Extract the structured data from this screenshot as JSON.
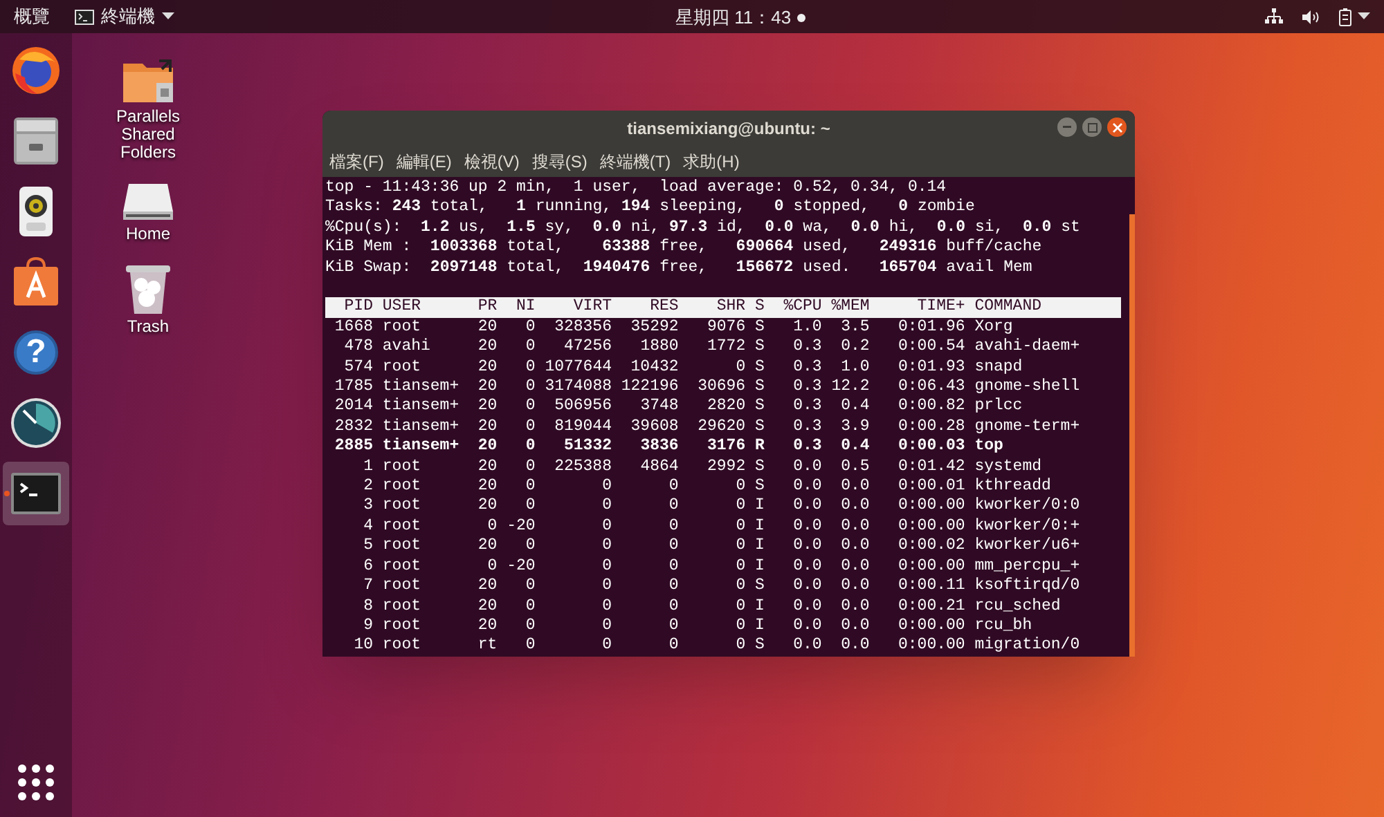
{
  "top_bar": {
    "activities": "概覽",
    "app_menu": "終端機",
    "clock": "星期四 11：43"
  },
  "dock": {
    "items": [
      {
        "kind": "firefox",
        "selected": false
      },
      {
        "kind": "files",
        "selected": false
      },
      {
        "kind": "speaker",
        "selected": false
      },
      {
        "kind": "software",
        "selected": false
      },
      {
        "kind": "help",
        "glyph": "?",
        "selected": false
      },
      {
        "kind": "gauge",
        "selected": false
      },
      {
        "kind": "terminal",
        "selected": true
      }
    ]
  },
  "desktop_icons": [
    {
      "kind": "shared-folder",
      "label": "Parallels Shared Folders"
    },
    {
      "kind": "drive",
      "label": "Home"
    },
    {
      "kind": "trash",
      "label": "Trash"
    }
  ],
  "terminal": {
    "title": "tiansemixiang@ubuntu: ~",
    "menu": [
      "檔案(F)",
      "編輯(E)",
      "檢視(V)",
      "搜尋(S)",
      "終端機(T)",
      "求助(H)"
    ],
    "summary": [
      "top - 11:43:36 up 2 min,  1 user,  load average: 0.52, 0.34, 0.14",
      "Tasks: **243** total,   **1** running, **194** sleeping,   **0** stopped,   **0** zombie",
      "%Cpu(s):  **1.2** us,  **1.5** sy,  **0.0** ni, **97.3** id,  **0.0** wa,  **0.0** hi,  **0.0** si,  **0.0** st",
      "KiB Mem :  **1003368** total,    **63388** free,   **690664** used,   **249316** buff/cache",
      "KiB Swap:  **2097148** total,  **1940476** free,   **156672** used.   **165704** avail Mem"
    ],
    "columns": [
      "PID",
      "USER",
      "PR",
      "NI",
      "VIRT",
      "RES",
      "SHR",
      "S",
      "%CPU",
      "%MEM",
      "TIME+",
      "COMMAND"
    ],
    "rows": [
      {
        "cells": [
          "1668",
          "root",
          "20",
          "0",
          "328356",
          "35292",
          "9076",
          "S",
          "1.0",
          "3.5",
          "0:01.96",
          "Xorg"
        ],
        "bold": false
      },
      {
        "cells": [
          "478",
          "avahi",
          "20",
          "0",
          "47256",
          "1880",
          "1772",
          "S",
          "0.3",
          "0.2",
          "0:00.54",
          "avahi-daem+"
        ],
        "bold": false
      },
      {
        "cells": [
          "574",
          "root",
          "20",
          "0",
          "1077644",
          "10432",
          "0",
          "S",
          "0.3",
          "1.0",
          "0:01.93",
          "snapd"
        ],
        "bold": false
      },
      {
        "cells": [
          "1785",
          "tiansem+",
          "20",
          "0",
          "3174088",
          "122196",
          "30696",
          "S",
          "0.3",
          "12.2",
          "0:06.43",
          "gnome-shell"
        ],
        "bold": false
      },
      {
        "cells": [
          "2014",
          "tiansem+",
          "20",
          "0",
          "506956",
          "3748",
          "2820",
          "S",
          "0.3",
          "0.4",
          "0:00.82",
          "prlcc"
        ],
        "bold": false
      },
      {
        "cells": [
          "2832",
          "tiansem+",
          "20",
          "0",
          "819044",
          "39608",
          "29620",
          "S",
          "0.3",
          "3.9",
          "0:00.28",
          "gnome-term+"
        ],
        "bold": false
      },
      {
        "cells": [
          "2885",
          "tiansem+",
          "20",
          "0",
          "51332",
          "3836",
          "3176",
          "R",
          "0.3",
          "0.4",
          "0:00.03",
          "top"
        ],
        "bold": true
      },
      {
        "cells": [
          "1",
          "root",
          "20",
          "0",
          "225388",
          "4864",
          "2992",
          "S",
          "0.0",
          "0.5",
          "0:01.42",
          "systemd"
        ],
        "bold": false
      },
      {
        "cells": [
          "2",
          "root",
          "20",
          "0",
          "0",
          "0",
          "0",
          "S",
          "0.0",
          "0.0",
          "0:00.01",
          "kthreadd"
        ],
        "bold": false
      },
      {
        "cells": [
          "3",
          "root",
          "20",
          "0",
          "0",
          "0",
          "0",
          "I",
          "0.0",
          "0.0",
          "0:00.00",
          "kworker/0:0"
        ],
        "bold": false
      },
      {
        "cells": [
          "4",
          "root",
          "0",
          "-20",
          "0",
          "0",
          "0",
          "I",
          "0.0",
          "0.0",
          "0:00.00",
          "kworker/0:+"
        ],
        "bold": false
      },
      {
        "cells": [
          "5",
          "root",
          "20",
          "0",
          "0",
          "0",
          "0",
          "I",
          "0.0",
          "0.0",
          "0:00.02",
          "kworker/u6+"
        ],
        "bold": false
      },
      {
        "cells": [
          "6",
          "root",
          "0",
          "-20",
          "0",
          "0",
          "0",
          "I",
          "0.0",
          "0.0",
          "0:00.00",
          "mm_percpu_+"
        ],
        "bold": false
      },
      {
        "cells": [
          "7",
          "root",
          "20",
          "0",
          "0",
          "0",
          "0",
          "S",
          "0.0",
          "0.0",
          "0:00.11",
          "ksoftirqd/0"
        ],
        "bold": false
      },
      {
        "cells": [
          "8",
          "root",
          "20",
          "0",
          "0",
          "0",
          "0",
          "I",
          "0.0",
          "0.0",
          "0:00.21",
          "rcu_sched"
        ],
        "bold": false
      },
      {
        "cells": [
          "9",
          "root",
          "20",
          "0",
          "0",
          "0",
          "0",
          "I",
          "0.0",
          "0.0",
          "0:00.00",
          "rcu_bh"
        ],
        "bold": false
      },
      {
        "cells": [
          "10",
          "root",
          "rt",
          "0",
          "0",
          "0",
          "0",
          "S",
          "0.0",
          "0.0",
          "0:00.00",
          "migration/0"
        ],
        "bold": false
      }
    ]
  }
}
